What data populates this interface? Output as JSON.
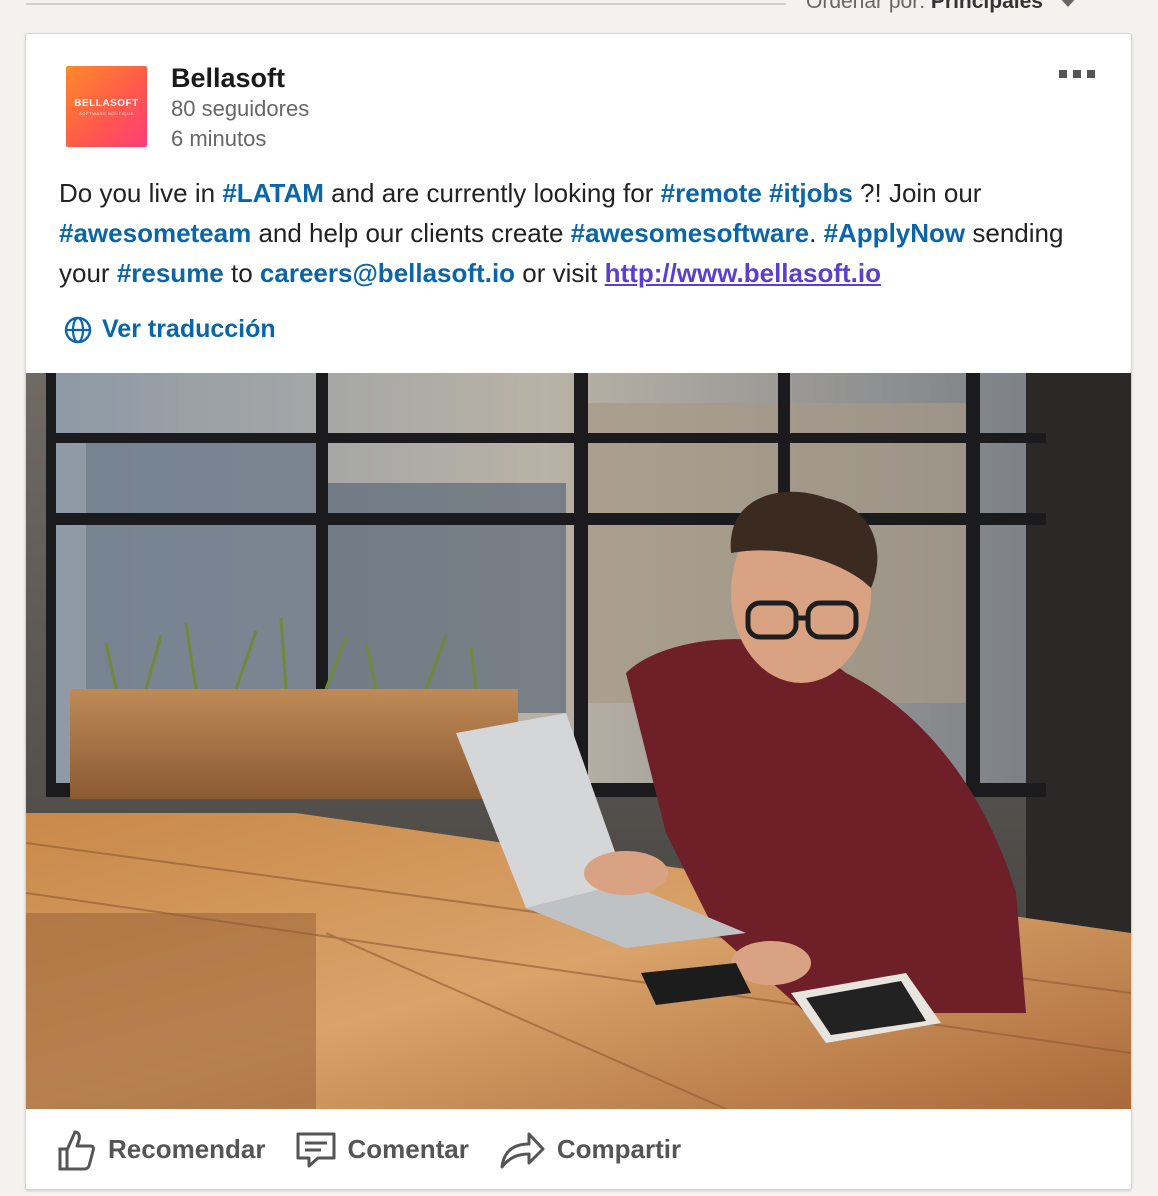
{
  "sort": {
    "label": "Ordenar por:",
    "value": "Principales"
  },
  "post": {
    "author": {
      "name": "Bellasoft",
      "followers": "80 seguidores",
      "time": "6 minutos",
      "logo_word": "BELLASOFT",
      "logo_tag": "SOFTWARE BOUTIQUE"
    },
    "text": {
      "p1": "Do you live in ",
      "tag_latam": "#LATAM",
      "p2": " and are currently looking for ",
      "tag_remote": "#remote",
      "tag_itjobs": "#itjobs",
      "p3": " ?! Join our ",
      "tag_awesometeam": "#awesometeam",
      "p4": " and help our clients create ",
      "tag_awesomesoftware": "#awesomesoftware",
      "p5": ". ",
      "tag_applynow": "#ApplyNow",
      "p6": " sending your ",
      "tag_resume": "#resume",
      "p7": " to ",
      "email": "careers@bellasoft.io",
      "p8": " or visit ",
      "url": "http://www.bellasoft.io"
    },
    "translate_label": "Ver traducción"
  },
  "actions": {
    "like": "Recomendar",
    "comment": "Comentar",
    "share": "Compartir"
  },
  "colors": {
    "link": "#0a66a8",
    "url": "#5b3fd0",
    "logo_start": "#ff8a2a",
    "logo_end": "#ff3c7a"
  }
}
